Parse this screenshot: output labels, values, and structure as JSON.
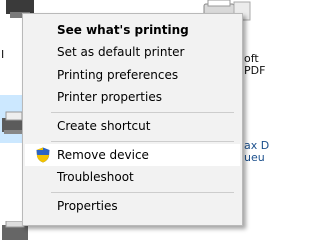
{
  "background": {
    "text_left": "I",
    "text_right": [
      "oft",
      "PDF",
      "ax D",
      "ueu"
    ]
  },
  "context_menu": {
    "items": [
      {
        "label": "See what's printing",
        "bold": true
      },
      {
        "label": "Set as default printer"
      },
      {
        "label": "Printing preferences"
      },
      {
        "label": "Printer properties"
      },
      {
        "label": "Create shortcut"
      },
      {
        "label": "Remove device",
        "icon": "uac-shield-icon",
        "hovered": true
      },
      {
        "label": "Troubleshoot"
      },
      {
        "label": "Properties"
      }
    ]
  },
  "colors": {
    "menu_background": "#f2f2f2",
    "hover_background": "#ffffff",
    "selection_highlight": "#cce8ff"
  }
}
